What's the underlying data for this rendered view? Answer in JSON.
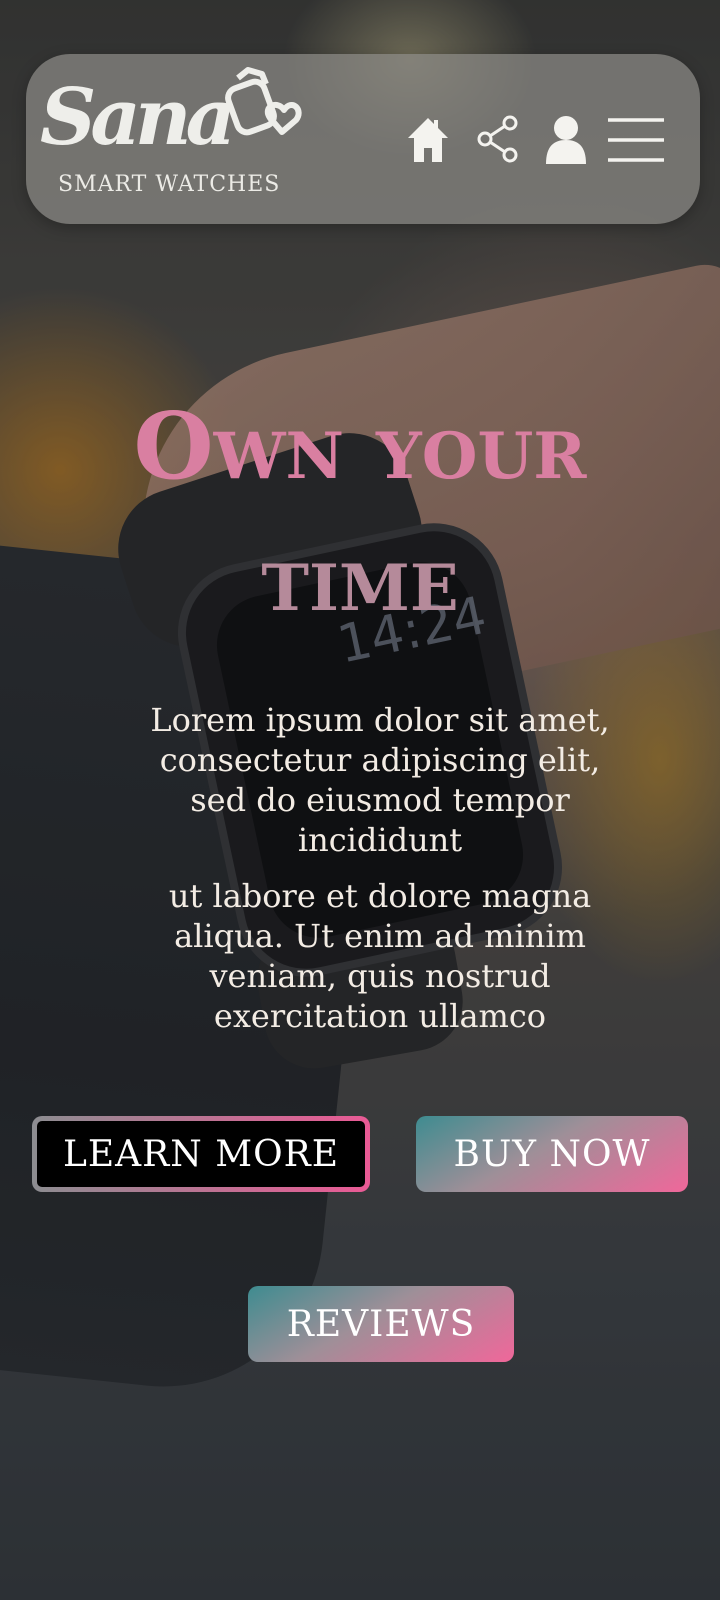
{
  "brand": {
    "logo_text": "Sana",
    "tagline": "SMART WATCHES"
  },
  "nav": {
    "icons": [
      "home-icon",
      "share-icon",
      "user-icon",
      "menu-icon"
    ]
  },
  "hero": {
    "title_line1": "Own your",
    "title_line2": "time",
    "paragraph1": "Lorem ipsum dolor sit amet, consectetur adipiscing elit, sed do eiusmod tempor incididunt",
    "paragraph2": "ut labore et dolore magna aliqua. Ut enim ad minim veniam, quis nostrud exercitation ullamco"
  },
  "buttons": {
    "learn_more": "LEARN MORE",
    "buy_now": "BUY NOW",
    "reviews": "REVIEWS"
  },
  "background_watch_time": "14:24",
  "colors": {
    "title_pink": "#d97fa1",
    "accent_pink": "#f0679a",
    "accent_teal": "#3e8c90",
    "header_bg": "#8c8a86"
  }
}
